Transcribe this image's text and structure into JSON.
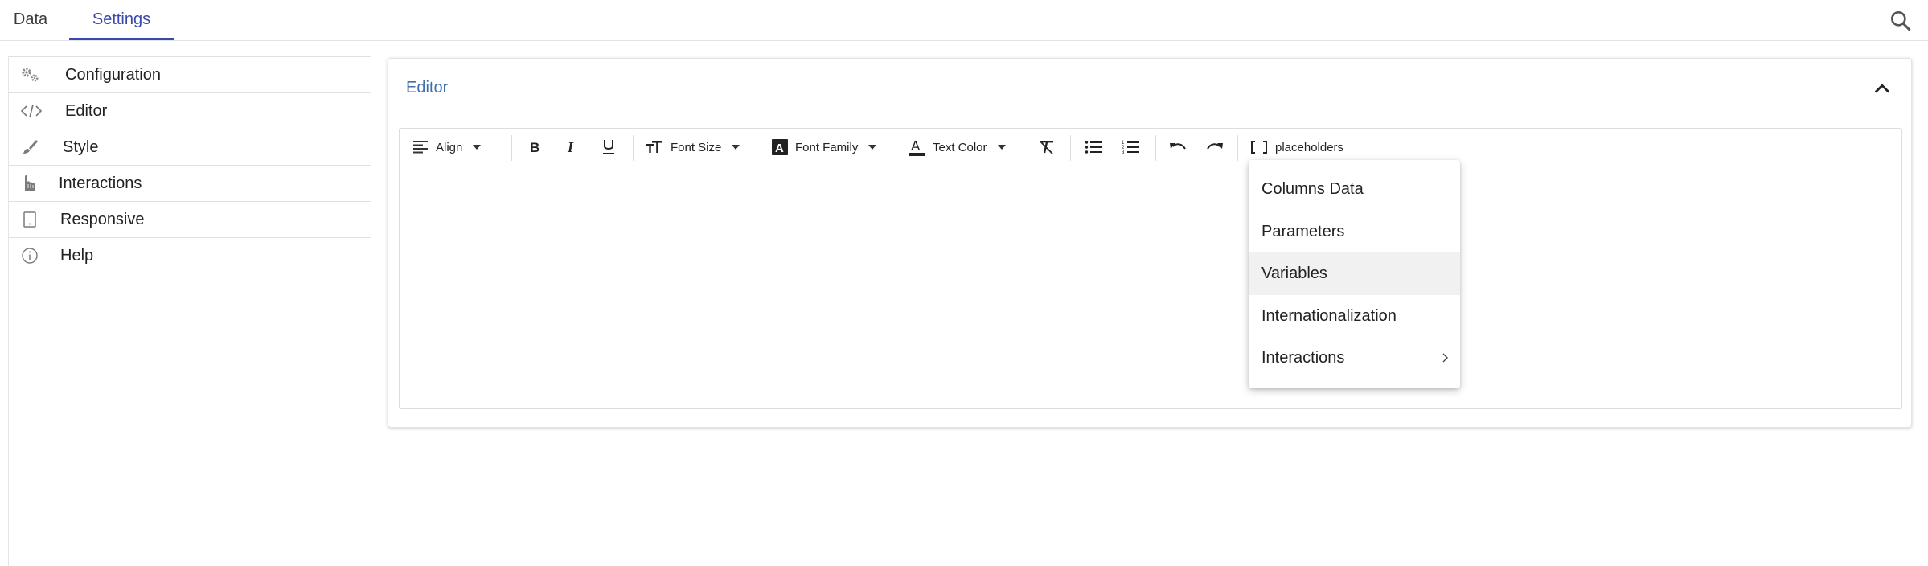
{
  "tabs": [
    {
      "label": "Data",
      "active": false
    },
    {
      "label": "Settings",
      "active": true
    }
  ],
  "header": {
    "search_icon": "search-icon"
  },
  "sidebar": {
    "items": [
      {
        "label": "Configuration",
        "icon": "gears-icon"
      },
      {
        "label": "Editor",
        "icon": "code-icon"
      },
      {
        "label": "Style",
        "icon": "paint-brush-icon"
      },
      {
        "label": "Interactions",
        "icon": "hand-pointer-icon"
      },
      {
        "label": "Responsive",
        "icon": "tablet-icon"
      },
      {
        "label": "Help",
        "icon": "info-icon"
      }
    ]
  },
  "panel": {
    "title": "Editor",
    "collapse_icon": "chevron-up-icon"
  },
  "toolbar": {
    "align_label": "Align",
    "font_size_label": "Font Size",
    "font_family_label": "Font Family",
    "text_color_label": "Text Color",
    "placeholders_label": "placeholders"
  },
  "placeholders_menu": {
    "items": [
      {
        "label": "Columns Data"
      },
      {
        "label": "Parameters"
      },
      {
        "label": "Variables",
        "highlighted": true
      },
      {
        "label": "Internationalization"
      },
      {
        "label": "Interactions",
        "has_submenu": true
      }
    ]
  },
  "colors": {
    "accent": "#3949ab",
    "panel_title": "#3f6fa5",
    "menu_highlight": "#f1f1f1"
  }
}
